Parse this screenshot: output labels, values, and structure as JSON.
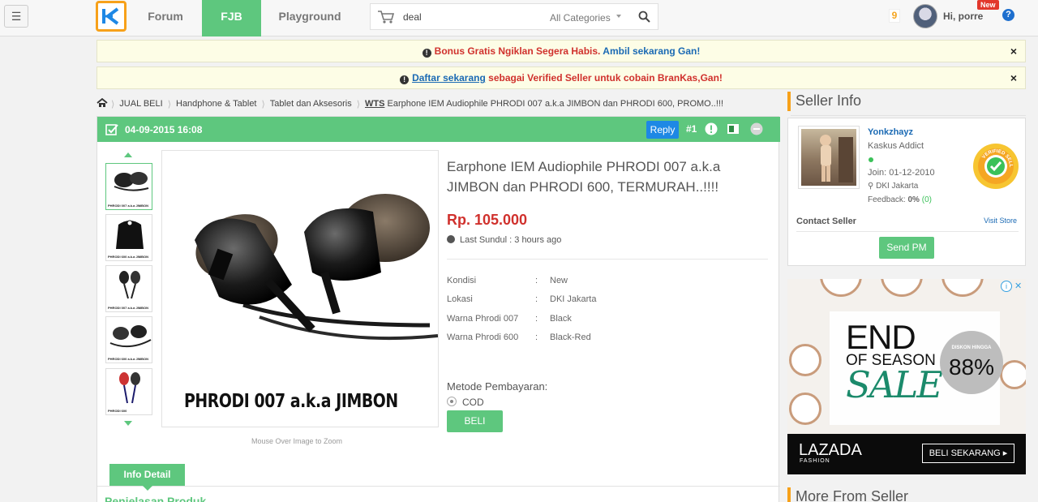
{
  "nav": {
    "menu_icon": "hamburger-icon",
    "logo_icon": "kaskus-logo-icon",
    "forum": "Forum",
    "fjb": "FJB",
    "playground": "Playground",
    "search_value": "deal",
    "search_category": "All Categories",
    "notifications": "9",
    "greeting": "Hi, porre",
    "new_badge": "New",
    "help": "?",
    "colors": {
      "active_tab": "#5ec77e",
      "logo_border": "#f7a11a"
    }
  },
  "banners": {
    "b1_red": "Bonus Gratis Ngiklan Segera Habis.",
    "b1_blue": "Ambil sekarang Gan!",
    "b2_link": "Daftar sekarang",
    "b2_text": " sebagai Verified Seller untuk cobain BranKas,Gan!",
    "close": "×"
  },
  "breadcrumb": {
    "home_icon": "home-icon",
    "items": [
      "JUAL BELI",
      "Handphone & Tablet",
      "Tablet dan Aksesoris"
    ],
    "prefix": "WTS",
    "current": "Earphone IEM Audiophile PHRODI 007 a.k.a JIMBON dan PHRODI 600, PROMO..!!!"
  },
  "post": {
    "date": "04-09-2015 16:08",
    "reply": "Reply",
    "number": "#1",
    "image_caption": "PHRODI 007 a.k.a JIMBON",
    "zoom_hint": "Mouse Over Image to Zoom",
    "title": "Earphone IEM Audiophile PHRODI 007 a.k.a JIMBON dan PHRODI 600, TERMURAH..!!!!",
    "price": "Rp. 105.000",
    "last_sundul": "Last Sundul : 3 hours ago",
    "specs": [
      {
        "label": "Kondisi",
        "value": "New"
      },
      {
        "label": "Lokasi",
        "value": "DKI Jakarta"
      },
      {
        "label": "Warna Phrodi 007",
        "value": "Black"
      },
      {
        "label": "Warna Phrodi 600",
        "value": "Black-Red"
      }
    ],
    "payment_title": "Metode Pembayaran:",
    "payment_option": "COD",
    "buy": "BELI",
    "tab_info": "Info Detail",
    "section_title": "Penjelasan Produk",
    "thumbnail_captions": [
      "PHRODI 007 a.k.a JIMBON",
      "PHRODI 600 a.k.a JIMBON",
      "PHRODI 007 a.k.a JIMBON",
      "PHRODI 600 a.k.a JIMBON",
      "PHRODI 600"
    ]
  },
  "seller": {
    "heading": "Seller Info",
    "name": "Yonkzhayz",
    "rank": "Kaskus Addict",
    "join": "Join: 01-12-2010",
    "location": "DKI Jakarta",
    "feedback_label": "Feedback:",
    "feedback_pct": "0%",
    "feedback_count": "0",
    "badge_text": "VERIFIED SELLER",
    "contact": "Contact Seller",
    "visit_store": "Visit Store",
    "send_pm": "Send PM"
  },
  "ad": {
    "headline_1": "END",
    "headline_2": "OF SEASON",
    "headline_3": "SALE",
    "discount_label": "DISKON HINGGA",
    "discount_value": "88%",
    "brand": "LAZADA",
    "brand_sub": "FASHION",
    "cta": "BELI SEKARANG ▸"
  },
  "more_from_seller": "More From Seller"
}
